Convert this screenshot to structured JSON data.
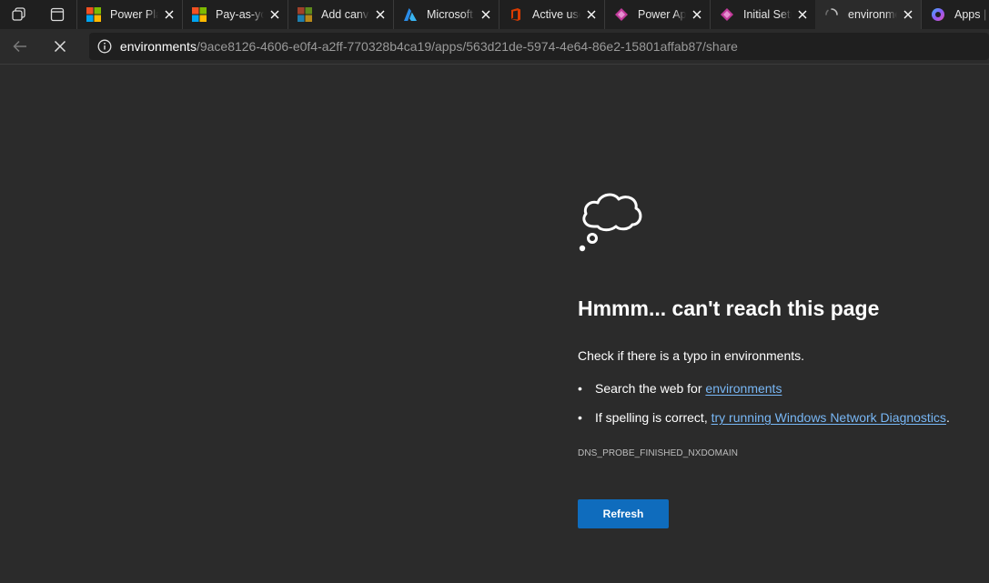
{
  "tabs": [
    {
      "title": "Power Platform",
      "icon": "microsoft-logo-icon"
    },
    {
      "title": "Pay-as-you-go",
      "icon": "microsoft-logo-icon"
    },
    {
      "title": "Add canvas",
      "icon": "microsoft-logo-dim-icon"
    },
    {
      "title": "Microsoft Azure",
      "icon": "azure-icon"
    },
    {
      "title": "Active users",
      "icon": "office-icon"
    },
    {
      "title": "Power Apps",
      "icon": "power-apps-icon"
    },
    {
      "title": "Initial Setup",
      "icon": "power-apps-icon"
    },
    {
      "title": "environments",
      "icon": "loading-spinner-icon",
      "active": true
    },
    {
      "title": "Apps | P",
      "icon": "copilot-icon"
    }
  ],
  "address": {
    "host": "environments",
    "path": "/9ace8126-4606-e0f4-a2ff-770328b4ca19/apps/563d21de-5974-4e64-86e2-15801affab87/share"
  },
  "error": {
    "title": "Hmmm... can't reach this page",
    "hint": "Check if there is a typo in environments.",
    "bullet1_prefix": "Search the web for ",
    "bullet1_link": "environments",
    "bullet2_prefix": "If spelling is correct, ",
    "bullet2_link": "try running Windows Network Diagnostics",
    "bullet2_suffix": ".",
    "code": "DNS_PROBE_FINISHED_NXDOMAIN",
    "refresh_label": "Refresh"
  },
  "colors": {
    "background": "#2b2b2b",
    "tabstrip": "#1f1f1f",
    "link": "#78b7f5",
    "accent_button": "#0f6cbd"
  }
}
